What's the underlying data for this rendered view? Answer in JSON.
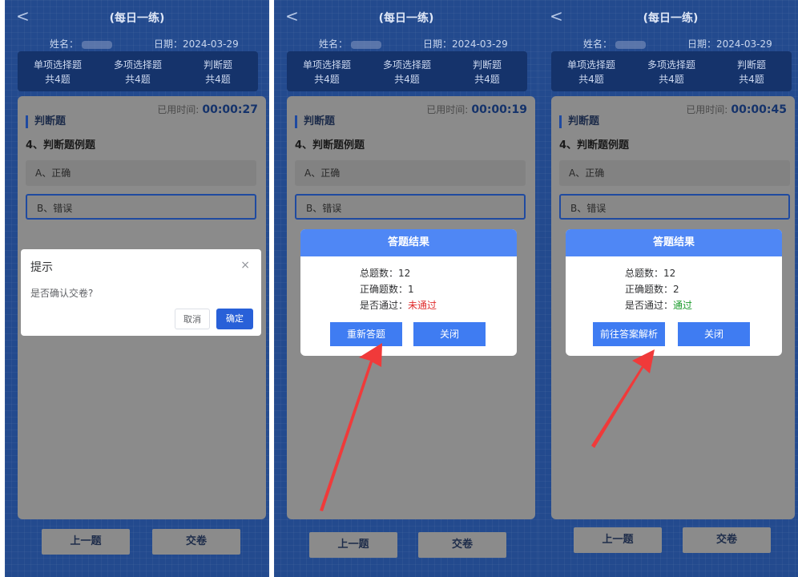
{
  "panels": [
    {
      "header": {
        "title": "(每日一练)"
      },
      "info": {
        "name_label": "姓名：",
        "date_label": "日期：2024-03-29"
      },
      "tabs": [
        {
          "label": "单项选择题",
          "count": "共4题"
        },
        {
          "label": "多项选择题",
          "count": "共4题"
        },
        {
          "label": "判断题",
          "count": "共4题"
        }
      ],
      "card": {
        "timer_label": "已用时间:",
        "timer_value": "00:00:27",
        "section": "判断题",
        "question": "4、判断题例题",
        "options": [
          "A、正确",
          "B、错误"
        ]
      },
      "footer": {
        "prev": "上一题",
        "submit": "交卷"
      },
      "confirm": {
        "title": "提示",
        "close_icon": "×",
        "message": "是否确认交卷?",
        "cancel": "取消",
        "ok": "确定"
      }
    },
    {
      "header": {
        "title": "(每日一练)"
      },
      "info": {
        "name_label": "姓名：",
        "date_label": "日期：2024-03-29"
      },
      "tabs": [
        {
          "label": "单项选择题",
          "count": "共4题"
        },
        {
          "label": "多项选择题",
          "count": "共4题"
        },
        {
          "label": "判断题",
          "count": "共4题"
        }
      ],
      "card": {
        "timer_label": "已用时间:",
        "timer_value": "00:00:19",
        "section": "判断题",
        "question": "4、判断题例题",
        "options": [
          "A、正确",
          "B、错误"
        ]
      },
      "footer": {
        "prev": "上一题",
        "submit": "交卷"
      },
      "result": {
        "title": "答题结果",
        "total_label": "总题数：12",
        "correct_label": "正确题数：1",
        "pass_label": "是否通过：",
        "pass_value": "未通过",
        "btn_left": "重新答题",
        "btn_right": "关闭"
      }
    },
    {
      "header": {
        "title": "(每日一练)"
      },
      "info": {
        "name_label": "姓名：",
        "date_label": "日期：2024-03-29"
      },
      "tabs": [
        {
          "label": "单项选择题",
          "count": "共4题"
        },
        {
          "label": "多项选择题",
          "count": "共4题"
        },
        {
          "label": "判断题",
          "count": "共4题"
        }
      ],
      "card": {
        "timer_label": "已用时间:",
        "timer_value": "00:00:45",
        "section": "判断题",
        "question": "4、判断题例题",
        "options": [
          "A、正确",
          "B、错误"
        ]
      },
      "footer": {
        "prev": "上一题",
        "submit": "交卷"
      },
      "result": {
        "title": "答题结果",
        "total_label": "总题数：12",
        "correct_label": "正确题数：2",
        "pass_label": "是否通过：",
        "pass_value": "通过",
        "btn_left": "前往答案解析",
        "btn_right": "关闭"
      }
    }
  ],
  "colors": {
    "background": "#234a8e",
    "accent": "#3f7cf2",
    "arrow": "#f03a3a",
    "fail": "#e02d2d",
    "pass": "#1a9b2b"
  }
}
